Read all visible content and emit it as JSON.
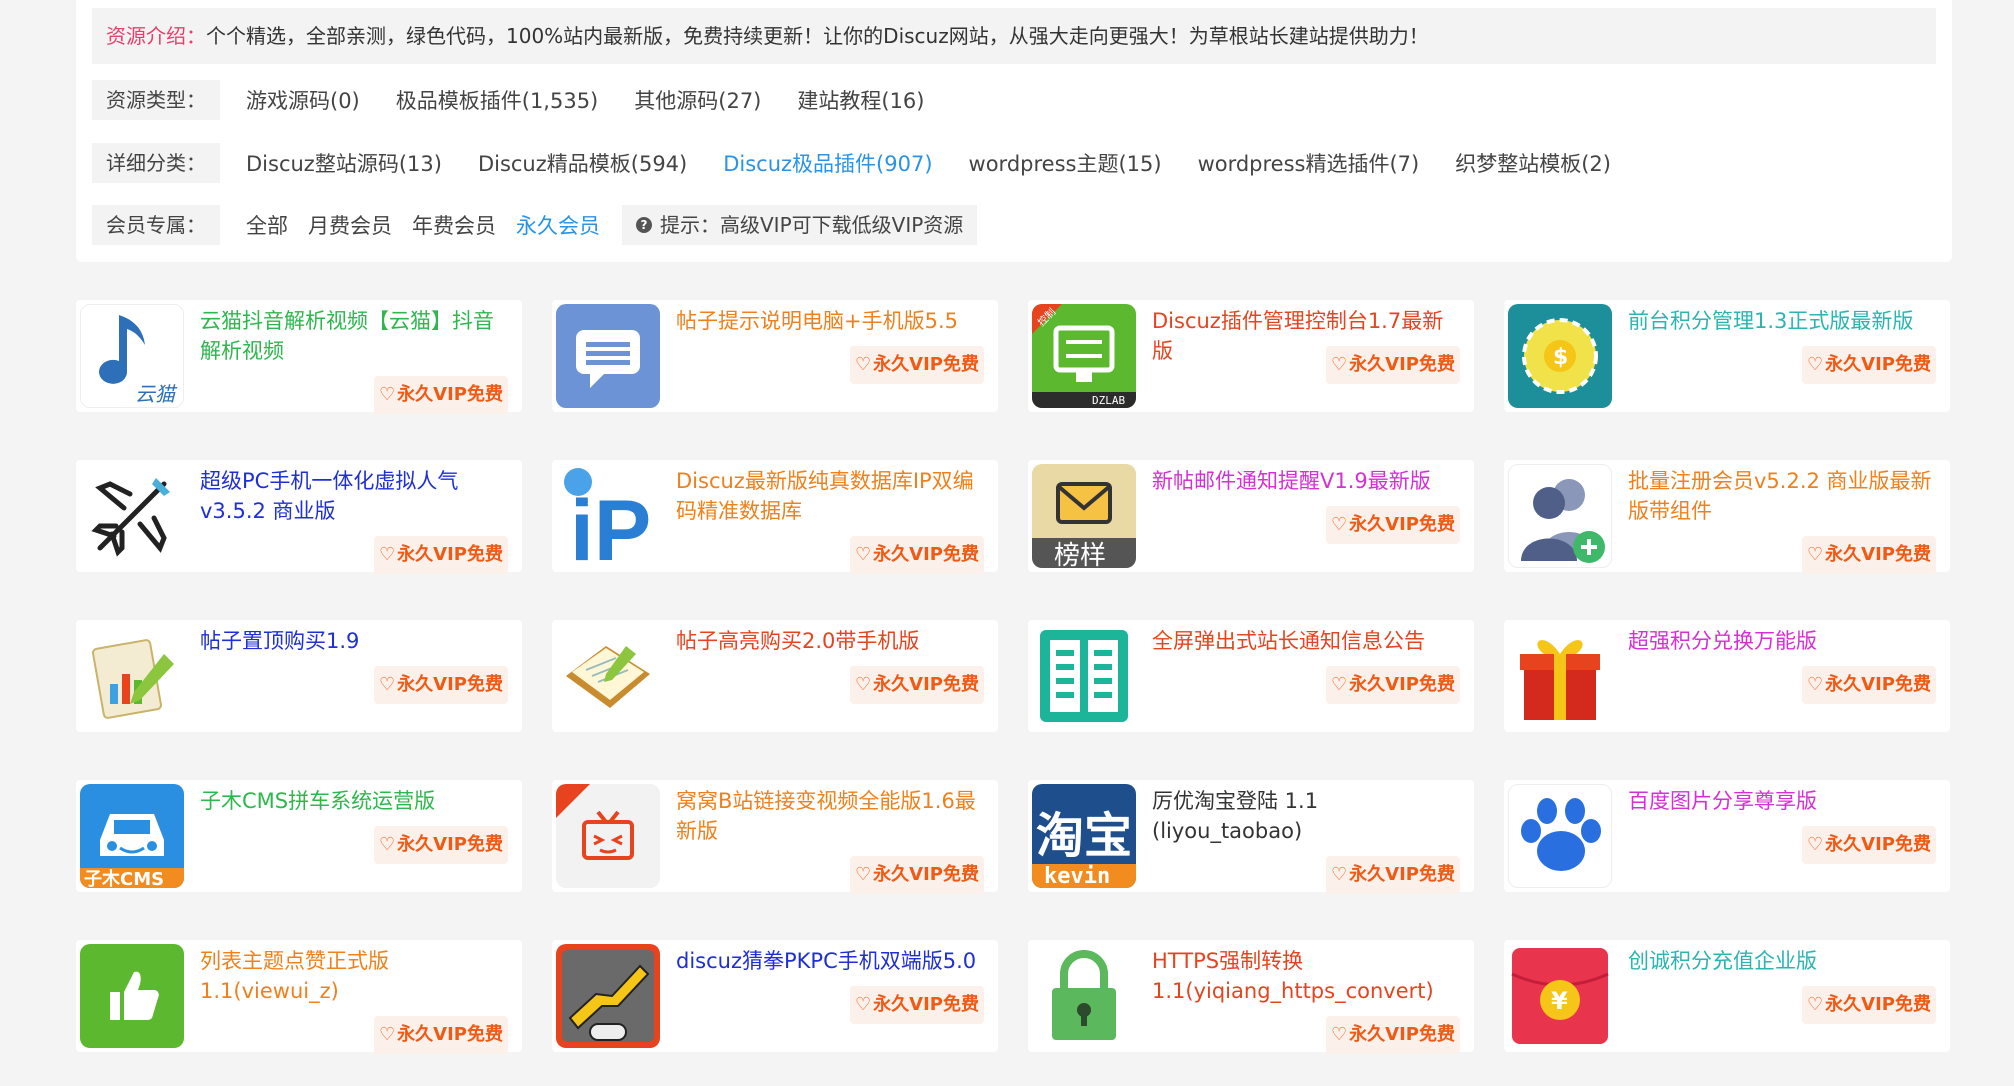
{
  "intro": {
    "label": "资源介绍：",
    "text": "个个精选，全部亲测，绿色代码，100%站内最新版，免费持续更新！让你的Discuz网站，从强大走向更强大！为草根站长建站提供助力！"
  },
  "filters": {
    "type": {
      "label": "资源类型：",
      "options": [
        "游戏源码(0)",
        "极品模板插件(1,535)",
        "其他源码(27)",
        "建站教程(16)"
      ]
    },
    "category": {
      "label": "详细分类：",
      "options": [
        "Discuz整站源码(13)",
        "Discuz精品模板(594)",
        "Discuz极品插件(907)",
        "wordpress主题(15)",
        "wordpress精选插件(7)",
        "织梦整站模板(2)"
      ],
      "active": "Discuz极品插件(907)"
    },
    "member": {
      "label": "会员专属：",
      "options": [
        "全部",
        "月费会员",
        "年费会员",
        "永久会员"
      ],
      "active": "永久会员",
      "tip": "提示：高级VIP可下载低级VIP资源",
      "tip_icon": "question-icon"
    }
  },
  "badge_label": "永久VIP免费",
  "badge_icon": "heart-outline-icon",
  "items": [
    {
      "title": "云猫抖音解析视频【云猫】抖音解析视频",
      "color": "#2db84d",
      "icon": "music-note-icon"
    },
    {
      "title": "帖子提示说明电脑+手机版5.5",
      "color": "#f0801a",
      "icon": "chat-bubble-icon"
    },
    {
      "title": "Discuz插件管理控制台1.7最新版",
      "color": "#e8431f",
      "icon": "monitor-control-icon"
    },
    {
      "title": "前台积分管理1.3正式版最新版",
      "color": "#2ab5b0",
      "icon": "gold-coin-icon"
    },
    {
      "title": "超级PC手机一体化虚拟人气v3.5.2 商业版",
      "color": "#1f2fd8",
      "icon": "airplane-icon"
    },
    {
      "title": "Discuz最新版纯真数据库IP双编码精准数据库",
      "color": "#f0801a",
      "icon": "ip-globe-icon"
    },
    {
      "title": "新帖邮件通知提醒V1.9最新版",
      "color": "#d62fd6",
      "icon": "mail-envelope-icon"
    },
    {
      "title": "批量注册会员v5.2.2 商业版最新版带组件",
      "color": "#f0801a",
      "icon": "add-users-icon"
    },
    {
      "title": "帖子置顶购买1.9",
      "color": "#1f2fd8",
      "icon": "chart-pencil-icon"
    },
    {
      "title": "帖子高亮购买2.0带手机版",
      "color": "#e8431f",
      "icon": "notepad-pencil-icon"
    },
    {
      "title": "全屏弹出式站长通知信息公告",
      "color": "#e8431f",
      "icon": "book-list-icon"
    },
    {
      "title": "超强积分兑换万能版",
      "color": "#d62fd6",
      "icon": "gift-box-icon"
    },
    {
      "title": "子木CMS拼车系统运营版",
      "color": "#2db84d",
      "icon": "car-icon"
    },
    {
      "title": "窝窝B站链接变视频全能版1.6最新版",
      "color": "#f0801a",
      "icon": "tv-icon"
    },
    {
      "title": "厉优淘宝登陆 1.1 (liyou_taobao)",
      "color": "#333333",
      "icon": "taobao-logo-icon"
    },
    {
      "title": "百度图片分享尊享版",
      "color": "#d62fd6",
      "icon": "paw-icon"
    },
    {
      "title": "列表主题点赞正式版 1.1(viewui_z)",
      "color": "#f0801a",
      "icon": "thumbs-up-icon"
    },
    {
      "title": "discuz猜拳PKPC手机双端版5.0",
      "color": "#1f2fd8",
      "icon": "handshake-game-icon"
    },
    {
      "title": "HTTPS强制转换 1.1(yiqiang_https_convert)",
      "color": "#e8431f",
      "icon": "padlock-icon"
    },
    {
      "title": "创诚积分充值企业版",
      "color": "#2ab5b0",
      "icon": "red-envelope-icon"
    }
  ],
  "icon_texts": {
    "yunmao": "云猫",
    "dzlab": "DZLAB",
    "control": "控制",
    "ip": "iP",
    "bangyang": "榜样",
    "taobao": "淘宝",
    "kevin": "kevin",
    "zimu": "子木CMS",
    "yuan": "¥"
  }
}
